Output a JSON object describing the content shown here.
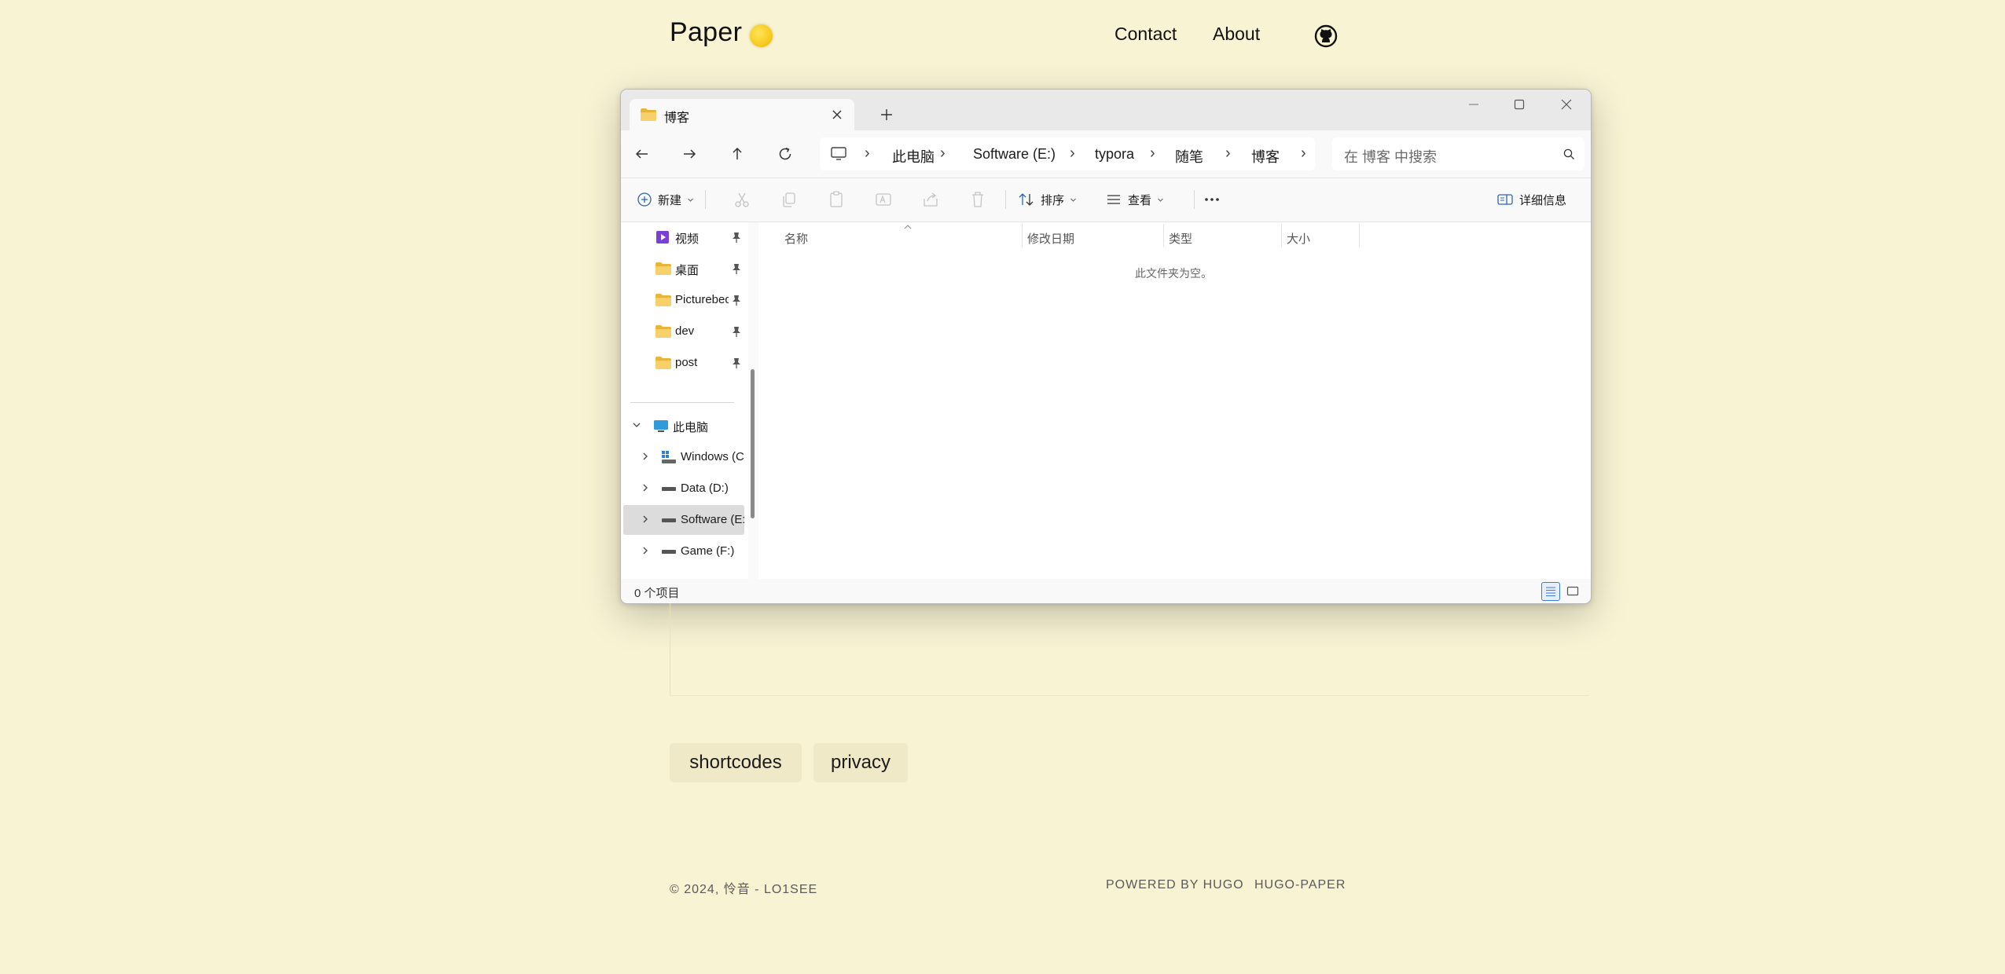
{
  "site": {
    "title": "Paper",
    "nav": {
      "contact": "Contact",
      "about": "About"
    }
  },
  "explorer": {
    "tab_title": "博客",
    "breadcrumb": [
      "此电脑",
      "Software (E:)",
      "typora",
      "随笔",
      "博客"
    ],
    "search_placeholder": "在 博客 中搜索",
    "toolbar": {
      "new_label": "新建",
      "sort_label": "排序",
      "view_label": "查看",
      "details_label": "详细信息"
    },
    "sidebar": {
      "quick_access": [
        {
          "label": "视频",
          "icon": "video-folder-icon"
        },
        {
          "label": "桌面",
          "icon": "folder-icon"
        },
        {
          "label": "Picturebed",
          "icon": "folder-icon"
        },
        {
          "label": "dev",
          "icon": "folder-icon"
        },
        {
          "label": "post",
          "icon": "folder-icon"
        }
      ],
      "this_pc": "此电脑",
      "drives": [
        {
          "label": "Windows (C:)",
          "icon": "windows-drive-icon"
        },
        {
          "label": "Data (D:)",
          "icon": "drive-icon"
        },
        {
          "label": "Software (E:)",
          "icon": "drive-icon",
          "selected": true
        },
        {
          "label": "Game (F:)",
          "icon": "drive-icon"
        }
      ]
    },
    "columns": {
      "name": "名称",
      "modified": "修改日期",
      "type": "类型",
      "size": "大小"
    },
    "empty_message": "此文件夹为空。",
    "status": "0 个项目"
  },
  "tags": [
    "shortcodes",
    "privacy"
  ],
  "footer": {
    "copyright": "© 2024, 怜音 - LO1SEE",
    "powered": "POWERED BY HUGO",
    "theme": "HUGO-PAPER"
  },
  "colors": {
    "page_background": "#f8f3d3",
    "tag_background": "#efe9c7",
    "folder_yellow": "#f5c542",
    "accent_blue": "#3c7bd6"
  }
}
